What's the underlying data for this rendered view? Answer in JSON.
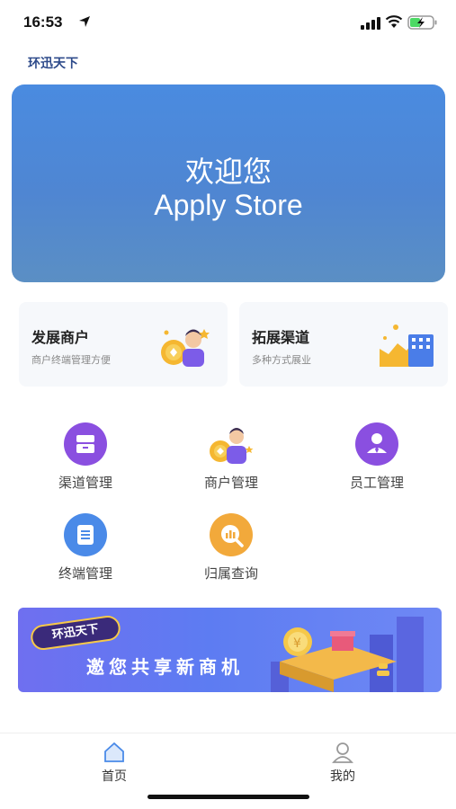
{
  "status_bar": {
    "time": "16:53",
    "icons": [
      "location-arrow-icon",
      "signal-icon",
      "wifi-icon",
      "battery-charging-icon"
    ]
  },
  "app": {
    "title": "环迅天下"
  },
  "hero": {
    "line1": "欢迎您",
    "line2": "Apply Store"
  },
  "cards": [
    {
      "title": "发展商户",
      "subtitle": "商户终端管理方便",
      "icon": "merchant-illustration"
    },
    {
      "title": "拓展渠道",
      "subtitle": "多种方式展业",
      "icon": "channel-chart-illustration"
    }
  ],
  "menu": [
    {
      "label": "渠道管理",
      "icon": "drawer-icon"
    },
    {
      "label": "商户管理",
      "icon": "merchant-person-icon"
    },
    {
      "label": "员工管理",
      "icon": "employee-icon"
    },
    {
      "label": "终端管理",
      "icon": "document-icon"
    },
    {
      "label": "归属查询",
      "icon": "search-chart-icon"
    }
  ],
  "promo": {
    "badge": "环迅天下",
    "text": "邀您共享新商机"
  },
  "tabbar": {
    "home_label": "首页",
    "mine_label": "我的"
  },
  "colors": {
    "hero_start": "#4a8be0",
    "hero_end": "#5b8fc4",
    "purple_icon": "#8a4fe0",
    "blue_icon": "#4a8ae8",
    "yellow_icon": "#f2a93b",
    "promo_bg": "#6275f2",
    "tab_active": "#4a8ae8"
  }
}
